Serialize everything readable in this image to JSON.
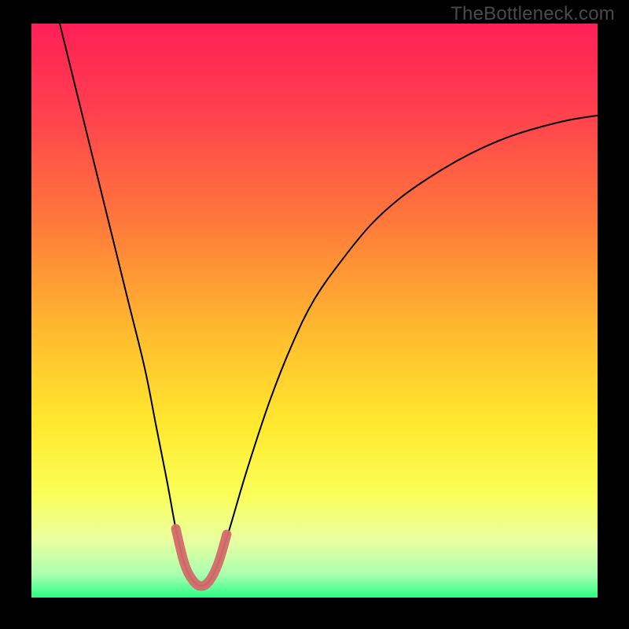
{
  "watermark": "TheBottleneck.com",
  "chart_data": {
    "type": "line",
    "title": "",
    "xlabel": "",
    "ylabel": "",
    "xlim": [
      0,
      100
    ],
    "ylim": [
      0,
      100
    ],
    "background_gradient": {
      "stops": [
        {
          "y": 0,
          "color": "#ff1f57"
        },
        {
          "y": 15,
          "color": "#ff3f4e"
        },
        {
          "y": 35,
          "color": "#ff7a3a"
        },
        {
          "y": 55,
          "color": "#ffbf2e"
        },
        {
          "y": 70,
          "color": "#ffe92e"
        },
        {
          "y": 82,
          "color": "#faff58"
        },
        {
          "y": 90,
          "color": "#e9ffa0"
        },
        {
          "y": 96,
          "color": "#aaffb0"
        },
        {
          "y": 100,
          "color": "#2bff85"
        }
      ]
    },
    "series": [
      {
        "name": "cost-curve",
        "color": "#000000",
        "width": 2,
        "x": [
          5,
          8,
          11,
          14,
          17,
          20,
          22,
          24,
          25.5,
          27,
          28.5,
          30,
          31.5,
          33,
          35,
          38,
          42,
          46,
          50,
          55,
          60,
          65,
          70,
          75,
          80,
          85,
          90,
          95,
          100
        ],
        "y": [
          100,
          88,
          76,
          64,
          52,
          40,
          30,
          20,
          12,
          6,
          3,
          2,
          3,
          6,
          12,
          22,
          34,
          44,
          52,
          59,
          65,
          69.5,
          73,
          76,
          78.5,
          80.5,
          82,
          83.2,
          84
        ]
      }
    ],
    "highlight_segment": {
      "name": "optimal-range",
      "color": "#d46a6a",
      "width": 12,
      "x": [
        25.5,
        27,
        28.5,
        30,
        31.5,
        33,
        34.5
      ],
      "y": [
        12,
        6,
        3,
        2,
        3,
        6,
        11
      ]
    }
  }
}
